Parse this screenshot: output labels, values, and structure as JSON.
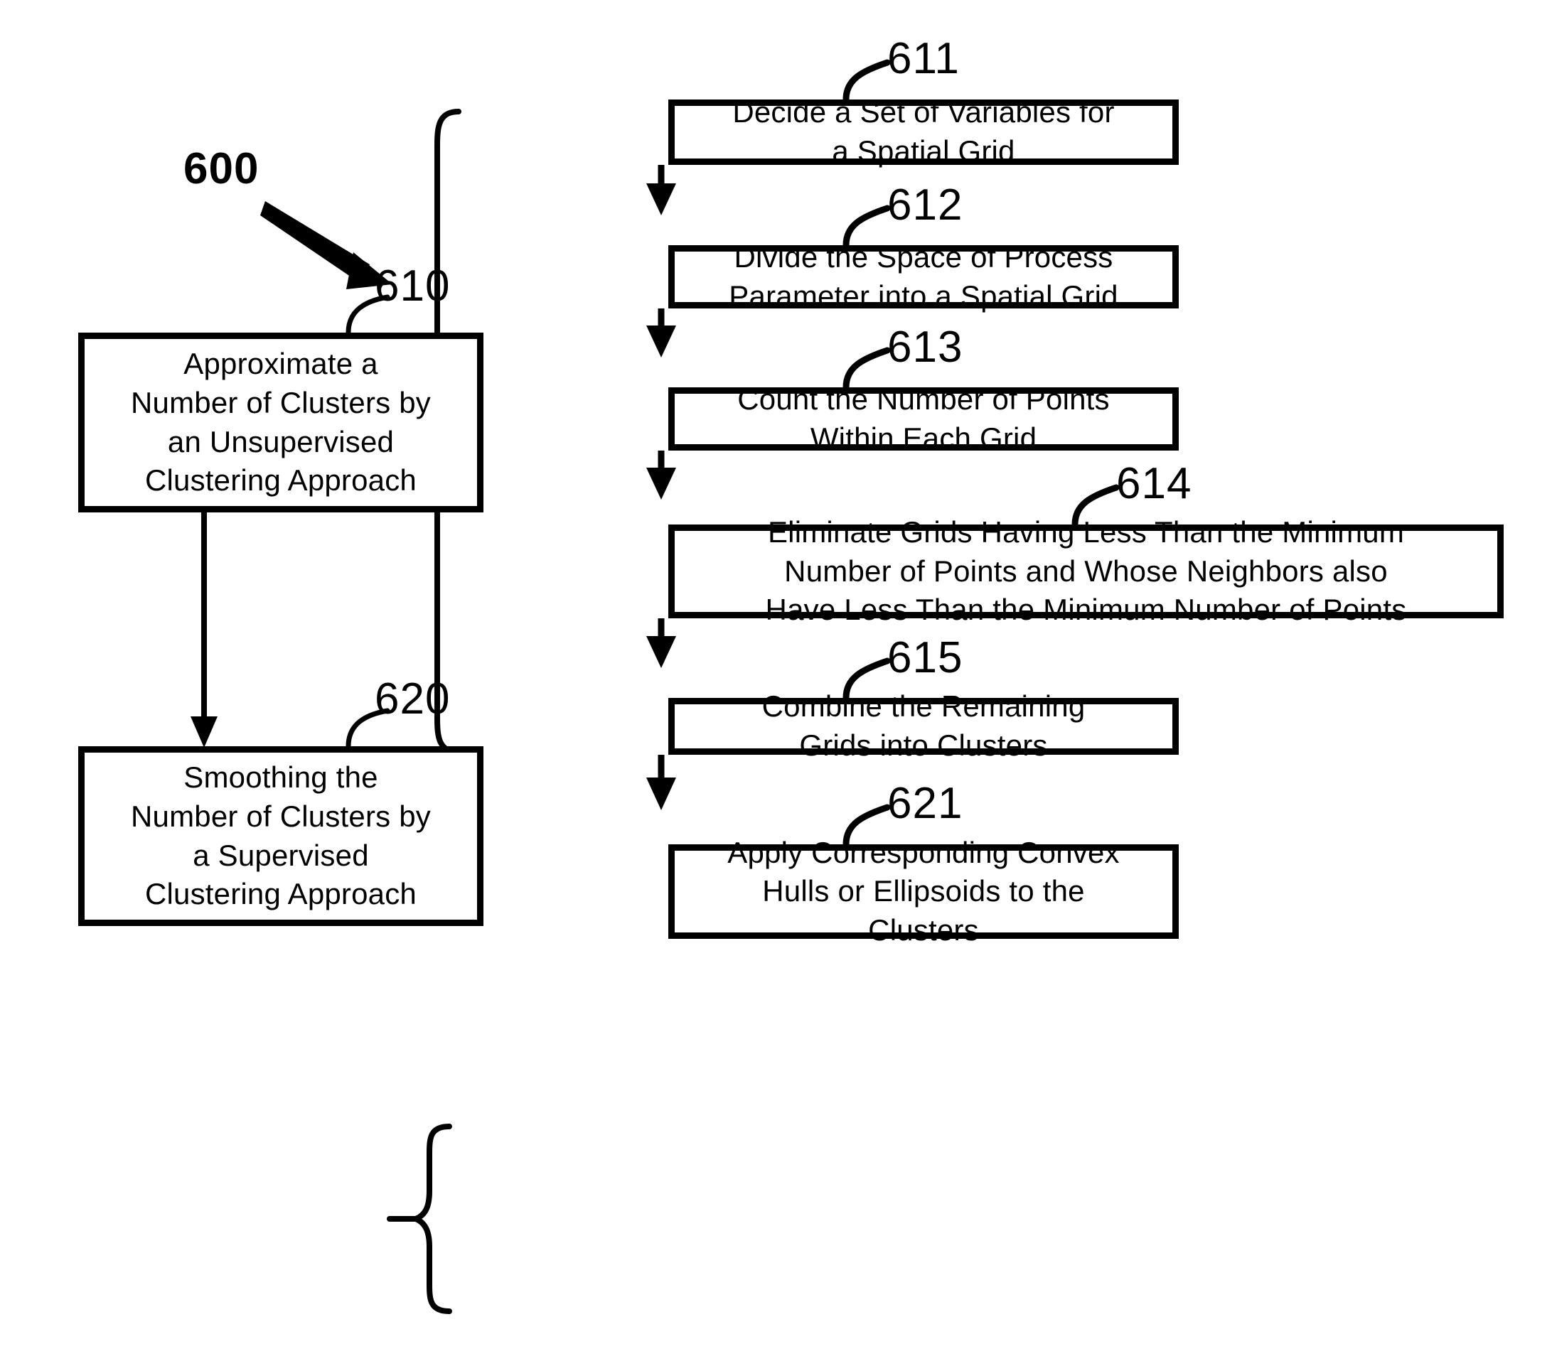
{
  "figure": {
    "number": "600",
    "title_ref": "600"
  },
  "refs": {
    "r600": "600",
    "r610": "610",
    "r611": "611",
    "r612": "612",
    "r613": "613",
    "r614": "614",
    "r615": "615",
    "r620": "620",
    "r621": "621"
  },
  "boxes": {
    "b610": {
      "ref": "610",
      "text": "Approximate a\nNumber of Clusters by\nan Unsupervised\nClustering Approach"
    },
    "b620": {
      "ref": "620",
      "text": "Smoothing the\nNumber of Clusters by\na Supervised\nClustering Approach"
    },
    "b611": {
      "ref": "611",
      "text": "Decide a Set of Variables for\na Spatial Grid"
    },
    "b612": {
      "ref": "612",
      "text": "Divide the Space of Process\nParameter into a Spatial Grid"
    },
    "b613": {
      "ref": "613",
      "text": "Count the Number of Points\nWithin Each Grid"
    },
    "b614": {
      "ref": "614",
      "text": "Eliminate Grids Having Less Than the Minimum\nNumber of Points and Whose Neighbors also\nHave Less Than the Minimum Number of Points"
    },
    "b615": {
      "ref": "615",
      "text": "Combine the Remaining\nGrids into Clusters"
    },
    "b621": {
      "ref": "621",
      "text": "Apply Corresponding Convex\nHulls or Ellipsoids to the\nClusters"
    }
  },
  "colors": {
    "line": "#000000",
    "background": "#ffffff"
  }
}
